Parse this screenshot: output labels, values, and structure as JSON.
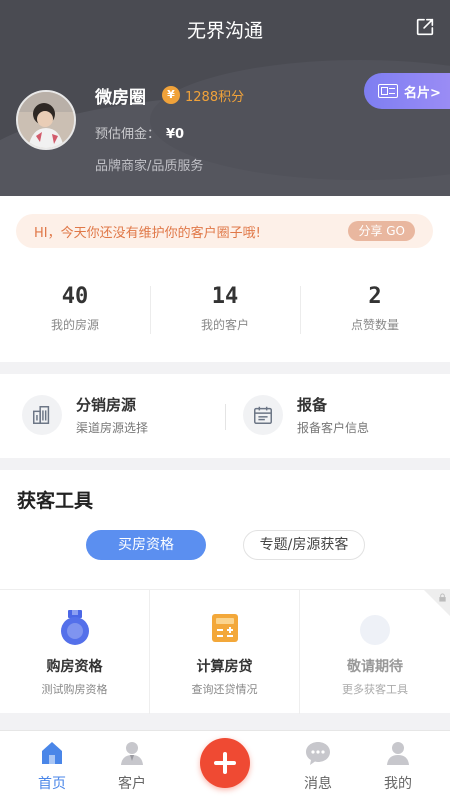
{
  "header": {
    "title": "无界沟通",
    "share_icon": "share-icon"
  },
  "profile": {
    "name": "微房圈",
    "points": "1288积分",
    "commission_label": "预估佣金：",
    "commission_value": "¥0",
    "tagline": "品牌商家/品质服务",
    "card_button": "名片>",
    "coin_symbol": "¥"
  },
  "notice": {
    "text": "HI，今天你还没有维护你的客户圈子哦!",
    "button": "分享 GO"
  },
  "stats": [
    {
      "value": "40",
      "label": "我的房源"
    },
    {
      "value": "14",
      "label": "我的客户"
    },
    {
      "value": "2",
      "label": "点赞数量"
    }
  ],
  "quick_links": [
    {
      "title": "分销房源",
      "subtitle": "渠道房源选择",
      "icon": "building-icon"
    },
    {
      "title": "报备",
      "subtitle": "报备客户信息",
      "icon": "calendar-icon"
    }
  ],
  "tools": {
    "title": "获客工具",
    "tabs": [
      {
        "label": "买房资格",
        "active": true
      },
      {
        "label": "专题/房源获客",
        "active": false
      }
    ],
    "items": [
      {
        "name": "购房资格",
        "desc": "测试购房资格",
        "icon": "badge-icon"
      },
      {
        "name": "计算房贷",
        "desc": "查询还贷情况",
        "icon": "calculator-icon"
      },
      {
        "name": "敬请期待",
        "desc": "更多获客工具",
        "icon": "placeholder-icon"
      }
    ]
  },
  "nav": {
    "items": [
      {
        "label": "首页",
        "icon": "home-icon",
        "active": true
      },
      {
        "label": "客户",
        "icon": "customer-icon",
        "active": false
      },
      {
        "label": "消息",
        "icon": "message-icon",
        "active": false
      },
      {
        "label": "我的",
        "icon": "profile-icon",
        "active": false
      }
    ],
    "fab_icon": "plus-icon"
  },
  "colors": {
    "header_bg": "#4a4b52",
    "accent_blue": "#5b8ff0",
    "accent_orange": "#f0a23a",
    "fab_red": "#ef4a33",
    "notice_text": "#e07848"
  }
}
